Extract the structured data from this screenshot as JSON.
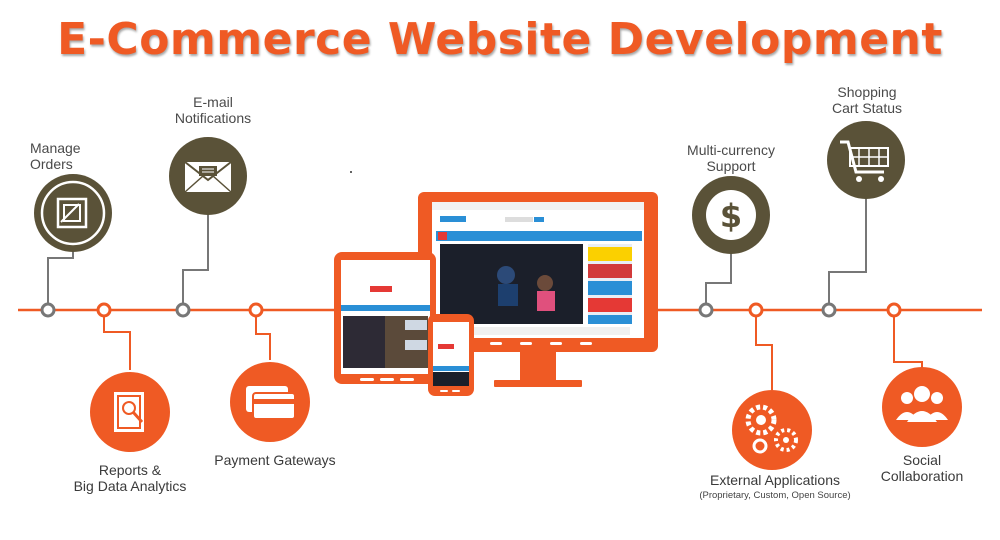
{
  "title": "E-Commerce Website Development",
  "features": {
    "manage_orders": {
      "label_line1": "Manage",
      "label_line2": "Orders",
      "icon": "orders-icon"
    },
    "email_notifications": {
      "label_line1": "E-mail",
      "label_line2": "Notifications",
      "icon": "envelope-icon"
    },
    "reports": {
      "label_line1": "Reports &",
      "label_line2": "Big Data Analytics",
      "icon": "analytics-icon"
    },
    "payment_gateways": {
      "label": "Payment Gateways",
      "icon": "credit-card-icon"
    },
    "multi_currency": {
      "label_line1": "Multi-currency",
      "label_line2": "Support",
      "icon": "dollar-icon"
    },
    "shopping_cart": {
      "label_line1": "Shopping",
      "label_line2": "Cart Status",
      "icon": "cart-icon"
    },
    "external_apps": {
      "label": "External Applications",
      "sublabel": "(Proprietary, Custom, Open Source)",
      "icon": "gears-icon"
    },
    "social": {
      "label_line1": "Social",
      "label_line2": "Collaboration",
      "icon": "people-icon"
    }
  },
  "colors": {
    "orange": "#ef5a24",
    "olive": "#5a5238",
    "connector_gray": "#777777",
    "screen_blue": "#2a8fd6"
  }
}
